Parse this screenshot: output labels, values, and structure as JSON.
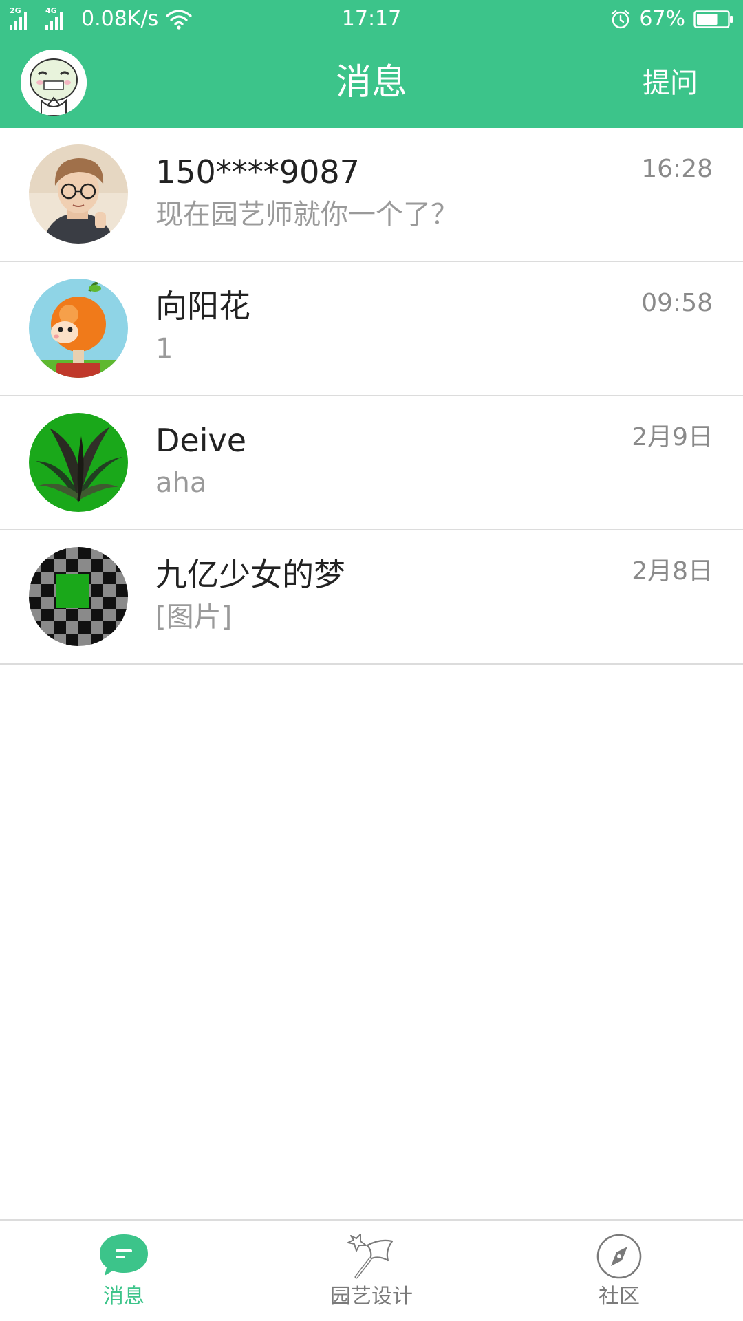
{
  "status_bar": {
    "signal_1_tag": "2G",
    "signal_2_tag": "4G",
    "net_speed": "0.08K/s",
    "time": "17:17",
    "battery_percent": "67%",
    "battery_level": 0.67,
    "icons": [
      "signal-icon",
      "wifi-icon",
      "alarm-icon",
      "battery-icon"
    ]
  },
  "header": {
    "title": "消息",
    "ask_label": "提问",
    "avatar_icon": "user-avatar"
  },
  "conversations": [
    {
      "name": "150****9087",
      "preview": "现在园艺师就你一个了？",
      "time": "16:28"
    },
    {
      "name": "向阳花",
      "preview": "1",
      "time": "09:58"
    },
    {
      "name": "Deive",
      "preview": "aha",
      "time": "2月9日"
    },
    {
      "name": "九亿少女的梦",
      "preview": "[图片]",
      "time": "2月8日"
    }
  ],
  "tabs": [
    {
      "label": "消息",
      "icon": "chat-bubble-icon",
      "active": true
    },
    {
      "label": "园艺设计",
      "icon": "magic-wand-icon",
      "active": false
    },
    {
      "label": "社区",
      "icon": "compass-icon",
      "active": false
    }
  ],
  "colors": {
    "brand_green": "#3cc48a",
    "text_primary": "#222222",
    "text_secondary": "#9a9a9a",
    "divider": "#dcdcdc"
  }
}
